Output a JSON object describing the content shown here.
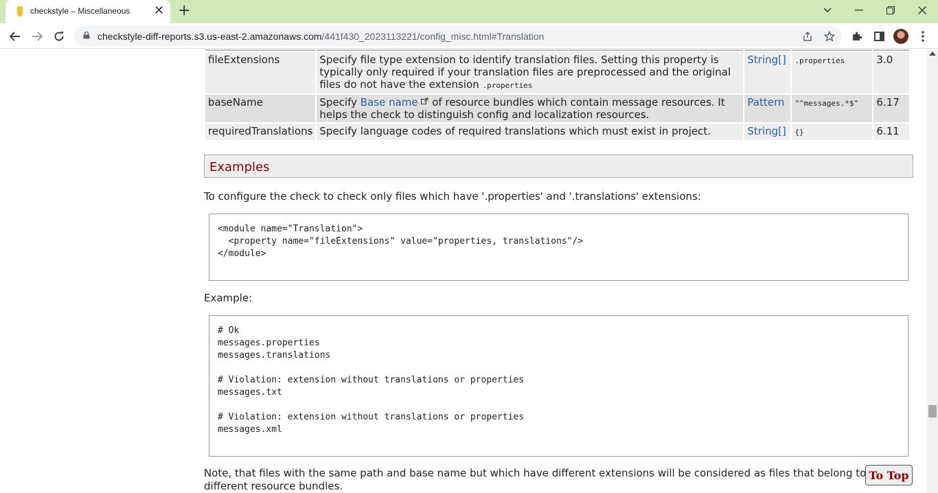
{
  "browser": {
    "tab_title": "checkstyle – Miscellaneous",
    "url_host": "checkstyle-diff-reports.s3.us-east-2.amazonaws.com",
    "url_path": "/441f430_2023113221/config_misc.html#Translation"
  },
  "properties_table": {
    "rows": [
      {
        "name": "fileExtensions",
        "desc_lines": [
          "Specify file type extension to identify translation files. Setting this property is",
          "typically only required if your translation files are preprocessed and the original",
          "files do not have the extension"
        ],
        "desc_code": ".properties",
        "type": "String[]",
        "default": ".properties",
        "since": "3.0"
      },
      {
        "name": "baseName",
        "desc_pre": "Specify",
        "desc_link": "Base name",
        "desc_post": "of resource bundles which contain message resources. It",
        "desc_line2": "helps the check to distinguish config and localization resources.",
        "type": "Pattern",
        "default": "\"^messages.*$\"",
        "since": "6.17"
      },
      {
        "name": "requiredTranslations",
        "desc": "Specify language codes of required translations which must exist in project.",
        "type": "String[]",
        "default": "{}",
        "since": "6.11"
      }
    ]
  },
  "examples": {
    "heading": "Examples",
    "intro": "To configure the check to check only files which have '.properties' and '.translations' extensions:",
    "config_code": [
      "<module name=\"Translation\">",
      "  <property name=\"fileExtensions\" value=\"properties, translations\"/>",
      "</module>"
    ],
    "example_label": "Example:",
    "example_code": [
      "# Ok",
      "messages.properties",
      "messages.translations",
      "",
      "# Violation: extension without translations or properties",
      "messages.txt",
      "",
      "# Violation: extension without translations or properties",
      "messages.xml"
    ],
    "note_line1": "Note, that files with the same path and base name but which have different extensions will be considered as files that belong to",
    "note_line2": "different resource bundles."
  },
  "to_top_label": "To Top"
}
